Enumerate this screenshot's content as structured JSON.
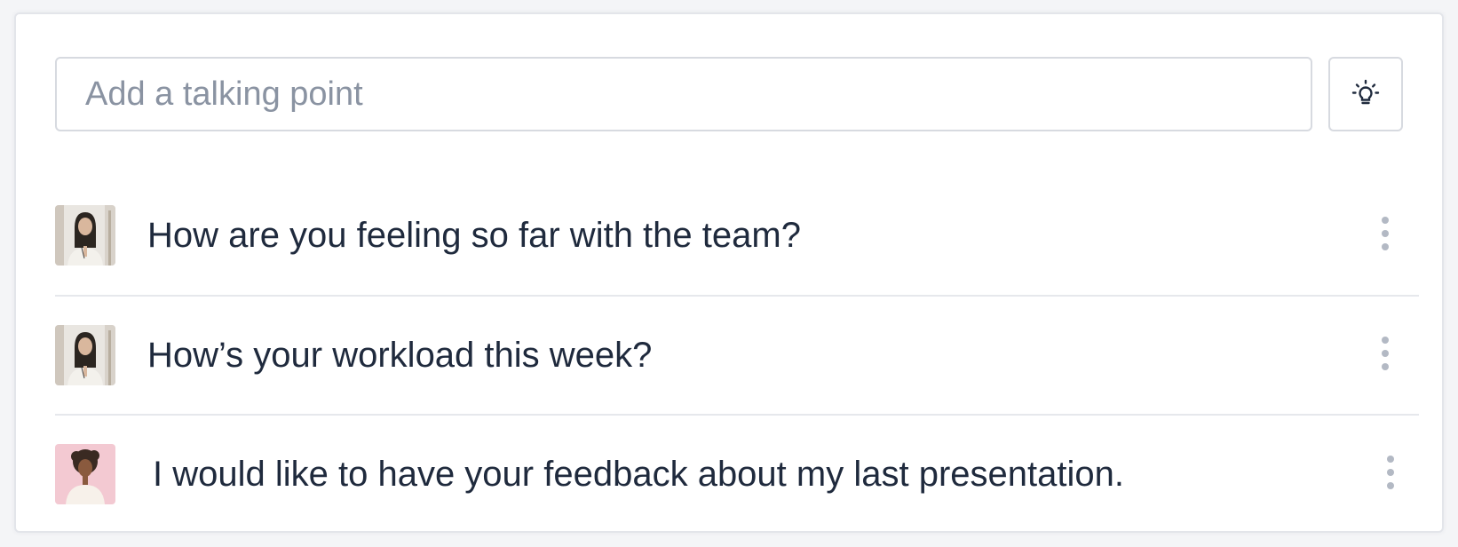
{
  "composer": {
    "placeholder": "Add a talking point",
    "value": "",
    "suggest_icon": "lightbulb-icon"
  },
  "talking_points": [
    {
      "text": "How are you feeling so far with the team?",
      "avatar": "avatar-woman-long-dark-hair",
      "menu_icon": "more-vertical-icon"
    },
    {
      "text": "How’s your workload this week?",
      "avatar": "avatar-woman-long-dark-hair",
      "menu_icon": "more-vertical-icon"
    },
    {
      "text": "I would like to have your feedback about my last presentation.",
      "avatar": "avatar-woman-curly-hair-pink-background",
      "menu_icon": "more-vertical-icon"
    }
  ],
  "colors": {
    "text": "#1f2a3d",
    "placeholder": "#8a93a2",
    "border": "#d7dae0",
    "divider": "#e6e8ec",
    "icon_muted": "#b3b9c4"
  }
}
